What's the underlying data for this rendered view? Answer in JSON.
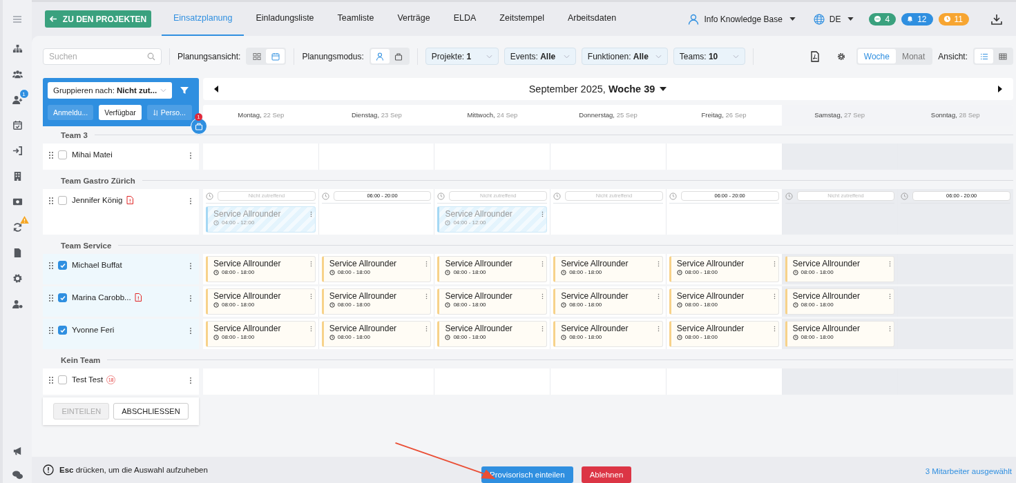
{
  "sidebar": {
    "user_badge": "1",
    "sync_warning": true
  },
  "topbar": {
    "back_button": "ZU DEN PROJEKTEN",
    "tabs": [
      {
        "label": "Einsatzplanung",
        "selected": true
      },
      {
        "label": "Einladungsliste",
        "selected": false
      },
      {
        "label": "Teamliste",
        "selected": false
      },
      {
        "label": "Verträge",
        "selected": false
      },
      {
        "label": "ELDA",
        "selected": false
      },
      {
        "label": "Zeitstempel",
        "selected": false
      },
      {
        "label": "Arbeitsdaten",
        "selected": false
      }
    ],
    "user": "Info Knowledge Base",
    "language": "DE",
    "counters": [
      {
        "value": "4",
        "color": "#3aa17e"
      },
      {
        "value": "12",
        "color": "#2f8fe0"
      },
      {
        "value": "11",
        "color": "#f7a531"
      }
    ]
  },
  "toolbar": {
    "search": {
      "placeholder": "Suchen"
    },
    "planning_view": {
      "label": "Planungsansicht:",
      "options": [
        {
          "selected": false
        },
        {
          "selected": true
        }
      ]
    },
    "planning_mode": {
      "label": "Planungsmodus:",
      "options": [
        {
          "selected": true
        },
        {
          "selected": false
        }
      ]
    },
    "filters": [
      {
        "label": "Projekte:",
        "value": "1"
      },
      {
        "label": "Events:",
        "value": "Alle"
      },
      {
        "label": "Funktionen:",
        "value": "Alle"
      },
      {
        "label": "Teams:",
        "value": "10"
      }
    ],
    "period": [
      {
        "label": "Woche",
        "selected": true
      },
      {
        "label": "Monat",
        "selected": false
      }
    ],
    "view": {
      "label": "Ansicht:",
      "options": [
        {
          "selected": true
        },
        {
          "selected": false
        }
      ]
    }
  },
  "panel": {
    "group_by": {
      "label": "Gruppieren nach:",
      "value": "Nicht zut..."
    },
    "chips": [
      {
        "label": "Anmeldu...",
        "selected": false
      },
      {
        "label": "Verfügbar",
        "selected": true
      },
      {
        "label": "Perso...",
        "selected": false
      }
    ],
    "job_badge": "1"
  },
  "week": {
    "month": "September 2025,",
    "week": "Woche 39"
  },
  "days": [
    {
      "weekday": "Montag,",
      "date": "22 Sep",
      "weekend": false
    },
    {
      "weekday": "Dienstag,",
      "date": "23 Sep",
      "weekend": false
    },
    {
      "weekday": "Mittwoch,",
      "date": "24 Sep",
      "weekend": false
    },
    {
      "weekday": "Donnerstag,",
      "date": "25 Sep",
      "weekend": false
    },
    {
      "weekday": "Freitag,",
      "date": "26 Sep",
      "weekend": false
    },
    {
      "weekday": "Samstag,",
      "date": "27 Sep",
      "weekend": true
    },
    {
      "weekday": "Sonntag,",
      "date": "28 Sep",
      "weekend": true
    }
  ],
  "groups": [
    {
      "name": "Team 3",
      "members": [
        {
          "name": "Mihai Matei",
          "checked": false,
          "doc_alert": false
        }
      ]
    },
    {
      "name": "Team Gastro Zürich",
      "members": [
        {
          "name": "Jennifer König",
          "checked": false,
          "doc_alert": true,
          "days": [
            {
              "availability": {
                "text": "Nicht zutreffend",
                "applicable": false
              },
              "shifts": [
                {
                  "title": "Service Allrounder",
                  "time": "04:00 - 12:00",
                  "kind": "provisional"
                }
              ]
            },
            {
              "availability": {
                "text": "06:00 - 20:00",
                "applicable": true
              }
            },
            {
              "availability": {
                "text": "Nicht zutreffend",
                "applicable": false
              },
              "shifts": [
                {
                  "title": "Service Allrounder",
                  "time": "04:00 - 12:00",
                  "kind": "provisional"
                }
              ]
            },
            {
              "availability": {
                "text": "Nicht zutreffend",
                "applicable": false
              }
            },
            {
              "availability": {
                "text": "06:00 - 20:00",
                "applicable": true
              }
            },
            {
              "availability": {
                "text": "Nicht zutreffend",
                "applicable": false
              }
            },
            {
              "availability": {
                "text": "06:00 - 20:00",
                "applicable": true
              }
            }
          ]
        }
      ]
    },
    {
      "name": "Team Service",
      "members": [
        {
          "name": "Michael Buffat",
          "checked": true,
          "doc_alert": false,
          "days": [
            {
              "shifts": [
                {
                  "title": "Service Allrounder",
                  "time": "08:00 - 18:00",
                  "kind": "confirmed"
                }
              ]
            },
            {
              "shifts": [
                {
                  "title": "Service Allrounder",
                  "time": "08:00 - 18:00",
                  "kind": "confirmed"
                }
              ]
            },
            {
              "shifts": [
                {
                  "title": "Service Allrounder",
                  "time": "08:00 - 18:00",
                  "kind": "confirmed"
                }
              ]
            },
            {
              "shifts": [
                {
                  "title": "Service Allrounder",
                  "time": "08:00 - 18:00",
                  "kind": "confirmed"
                }
              ]
            },
            {
              "shifts": [
                {
                  "title": "Service Allrounder",
                  "time": "08:00 - 18:00",
                  "kind": "confirmed"
                }
              ]
            },
            {
              "shifts": [
                {
                  "title": "Service Allrounder",
                  "time": "08:00 - 18:00",
                  "kind": "confirmed"
                }
              ]
            }
          ]
        },
        {
          "name": "Marina Carobb...",
          "checked": true,
          "doc_alert": true,
          "days": [
            {
              "shifts": [
                {
                  "title": "Service Allrounder",
                  "time": "08:00 - 18:00",
                  "kind": "confirmed"
                }
              ]
            },
            {
              "shifts": [
                {
                  "title": "Service Allrounder",
                  "time": "08:00 - 18:00",
                  "kind": "confirmed"
                }
              ]
            },
            {
              "shifts": [
                {
                  "title": "Service Allrounder",
                  "time": "08:00 - 18:00",
                  "kind": "confirmed"
                }
              ]
            },
            {
              "shifts": [
                {
                  "title": "Service Allrounder",
                  "time": "08:00 - 18:00",
                  "kind": "confirmed"
                }
              ]
            },
            {
              "shifts": [
                {
                  "title": "Service Allrounder",
                  "time": "08:00 - 18:00",
                  "kind": "confirmed"
                }
              ]
            },
            {
              "shifts": [
                {
                  "title": "Service Allrounder",
                  "time": "08:00 - 18:00",
                  "kind": "confirmed"
                }
              ]
            }
          ]
        },
        {
          "name": "Yvonne Feri",
          "checked": true,
          "doc_alert": false,
          "days": [
            {
              "shifts": [
                {
                  "title": "Service Allrounder",
                  "time": "08:00 - 18:00",
                  "kind": "confirmed"
                }
              ]
            },
            {
              "shifts": [
                {
                  "title": "Service Allrounder",
                  "time": "08:00 - 18:00",
                  "kind": "confirmed"
                }
              ]
            },
            {
              "shifts": [
                {
                  "title": "Service Allrounder",
                  "time": "08:00 - 18:00",
                  "kind": "confirmed"
                }
              ]
            },
            {
              "shifts": [
                {
                  "title": "Service Allrounder",
                  "time": "08:00 - 18:00",
                  "kind": "confirmed"
                }
              ]
            },
            {
              "shifts": [
                {
                  "title": "Service Allrounder",
                  "time": "08:00 - 18:00",
                  "kind": "confirmed"
                }
              ]
            },
            {
              "shifts": [
                {
                  "title": "Service Allrounder",
                  "time": "08:00 - 18:00",
                  "kind": "confirmed"
                }
              ]
            }
          ]
        }
      ]
    },
    {
      "name": "Kein Team",
      "members": [
        {
          "name": "Test Test",
          "checked": false,
          "doc_alert": false,
          "badge": "18"
        }
      ]
    }
  ],
  "actions": [
    {
      "label": "EINTEILEN",
      "disabled": true
    },
    {
      "label": "ABSCHLIESSEN",
      "disabled": false
    }
  ],
  "footer": {
    "hint": "**Esc** drücken, um die Auswahl aufzuheben",
    "buttons": [
      {
        "label": "Provisorisch einteilen",
        "kind": "primary"
      },
      {
        "label": "Ablehnen",
        "kind": "danger"
      }
    ],
    "selection": "3 Mitarbeiter ausgewählt"
  }
}
